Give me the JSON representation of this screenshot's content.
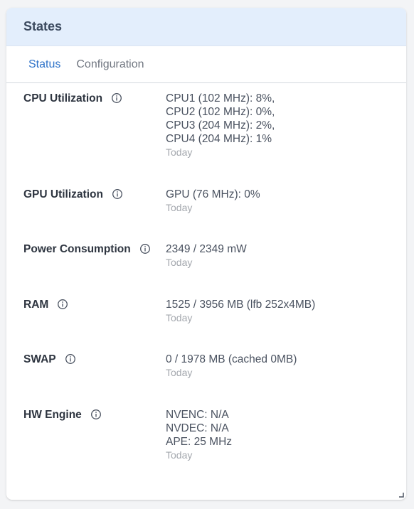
{
  "card": {
    "title": "States"
  },
  "tabs": [
    {
      "label": "Status",
      "active": true
    },
    {
      "label": "Configuration",
      "active": false
    }
  ],
  "rows": [
    {
      "label": "CPU Utilization",
      "values": [
        "CPU1 (102 MHz): 8%,",
        "CPU2 (102 MHz): 0%,",
        "CPU3 (204 MHz): 2%,",
        "CPU4 (204 MHz): 1%"
      ],
      "timestamp": "Today"
    },
    {
      "label": "GPU Utilization",
      "values": [
        "GPU (76 MHz): 0%"
      ],
      "timestamp": "Today"
    },
    {
      "label": "Power Consumption",
      "values": [
        "2349 / 2349 mW"
      ],
      "timestamp": "Today"
    },
    {
      "label": "RAM",
      "values": [
        "1525 / 3956 MB (lfb 252x4MB)"
      ],
      "timestamp": "Today"
    },
    {
      "label": "SWAP",
      "values": [
        "0 / 1978 MB (cached 0MB)"
      ],
      "timestamp": "Today"
    },
    {
      "label": "HW Engine",
      "values": [
        "NVENC: N/A",
        "NVDEC: N/A",
        "APE: 25 MHz"
      ],
      "timestamp": "Today"
    }
  ],
  "colors": {
    "header_bg": "#e3eefc",
    "active_tab": "#2f73c9",
    "label": "#2e3540",
    "value": "#4a5260",
    "timestamp": "#a4a8ae"
  }
}
